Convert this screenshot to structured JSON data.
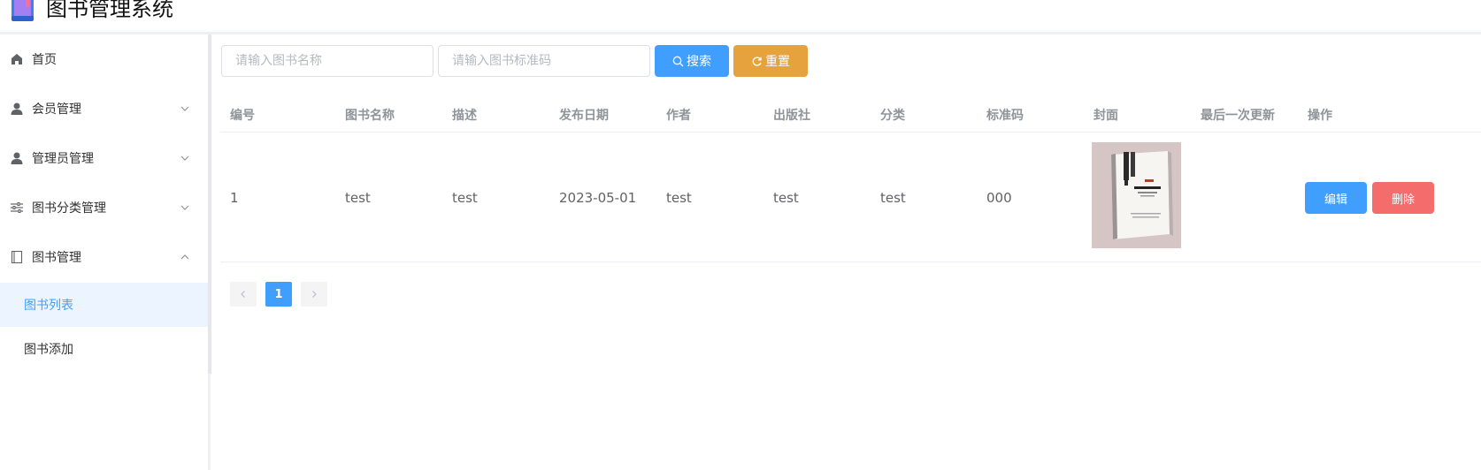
{
  "app": {
    "title": "图书管理系统",
    "brand_color": "#409eff"
  },
  "sidebar": {
    "items": [
      {
        "label": "首页",
        "icon": "home-icon",
        "expandable": false
      },
      {
        "label": "会员管理",
        "icon": "user-icon",
        "expandable": true,
        "expanded": false
      },
      {
        "label": "管理员管理",
        "icon": "user-icon",
        "expandable": true,
        "expanded": false
      },
      {
        "label": "图书分类管理",
        "icon": "sliders-icon",
        "expandable": true,
        "expanded": false
      },
      {
        "label": "图书管理",
        "icon": "notebook-icon",
        "expandable": true,
        "expanded": true
      }
    ],
    "sub_items": [
      {
        "label": "图书列表",
        "active": true
      },
      {
        "label": "图书添加",
        "active": false
      }
    ]
  },
  "search": {
    "name_placeholder": "请输入图书名称",
    "code_placeholder": "请输入图书标准码",
    "search_label": "搜索",
    "reset_label": "重置",
    "search_color": "#409eff",
    "reset_color": "#e6a23c"
  },
  "table": {
    "columns": [
      "编号",
      "图书名称",
      "描述",
      "发布日期",
      "作者",
      "出版社",
      "分类",
      "标准码",
      "封面",
      "最后一次更新",
      "操作"
    ],
    "rows": [
      {
        "id": "1",
        "name": "test",
        "description": "test",
        "publish_date": "2023-05-01",
        "author": "test",
        "publisher": "test",
        "category": "test",
        "code": "000",
        "cover": "book-cover-image",
        "last_updated": "",
        "actions": {
          "edit": "编辑",
          "delete": "删除"
        }
      }
    ]
  },
  "pagination": {
    "current_page": "1",
    "prev_icon": "chevron-left-icon",
    "next_icon": "chevron-right-icon"
  }
}
